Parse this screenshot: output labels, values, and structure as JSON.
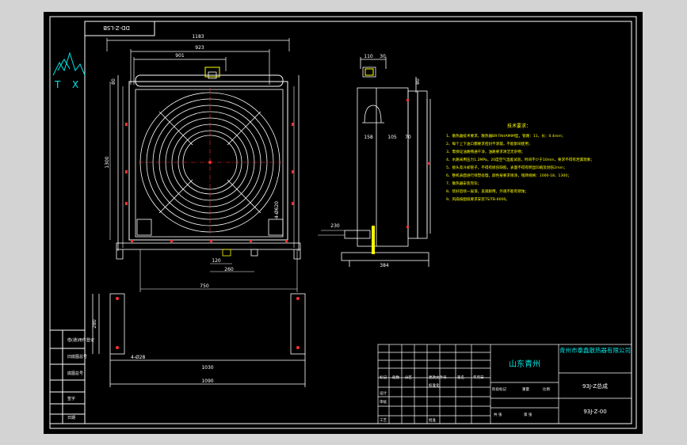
{
  "drawing_number_rotated": "DD-Z-LSB",
  "logo_letters": [
    "T",
    "X"
  ],
  "front_view": {
    "dims": {
      "overall_width": "1183",
      "width_923": "923",
      "width_901": "901",
      "height_left": "1300",
      "fan_dia_label": "4-Ø620",
      "dim_120": "120",
      "dim_260": "260",
      "dim_750": "750",
      "dim_80": "80"
    }
  },
  "side_view": {
    "dims": {
      "d110": "110",
      "d30": "30",
      "d80": "80",
      "d158": "158",
      "d105": "105",
      "d70": "70",
      "d230": "230",
      "d384": "384"
    }
  },
  "base_view": {
    "dims": {
      "d280": "280",
      "hole": "4-Ø28",
      "d1030": "1030",
      "d1090": "1090"
    }
  },
  "tech_notes": {
    "title": "技术要求：",
    "items": [
      "1、散热器技术要求，散热器BR-TAHAMIM型，管路：11，长：0.4mm；",
      "2、每个上下油口都要求密封不渗漏，不能影响使用；",
      "3、需保证油路畅通干净，油路要求清洁无杂物；",
      "4、水路采用压力1.2MPa，20度空气温差试验，时间不少于10min，要求不得有泄漏现象；",
      "5、接头及冷却管子，不得有损伤缺陷，表面不得有明显凹痕及划伤2mm；",
      "6、整机表面进行喷塑处理，颜色按要求喷涂，铭牌规格：1000-18、1300；",
      "7、散热器安装完毕；",
      "8、装好后喷一层漆，美观耐用，外观不能有锈蚀；",
      "9、风扇按图纸要求安装TS/TB-6000。"
    ]
  },
  "title_block": {
    "place": "山东青州",
    "company": "青州市泰鑫散热器有限公司",
    "product": "93J-Z总成",
    "drawing_no": "93J-Z-00",
    "labels": {
      "r1": [
        "标记",
        "处数",
        "分区",
        "更改文件号",
        "签名",
        "年月日"
      ],
      "r2": [
        "设计",
        "",
        "标准化",
        "",
        "阶段标记",
        "重量",
        "比例"
      ],
      "r3": [
        "审核",
        "",
        "",
        "",
        "",
        ""
      ],
      "r4": [
        "工艺",
        "",
        "批准",
        "",
        "共 张",
        "第 张"
      ]
    }
  },
  "left_strip": {
    "rows": [
      "借(通)用件登记",
      "旧底图总号",
      "底图总号",
      "签字",
      "日期"
    ]
  }
}
